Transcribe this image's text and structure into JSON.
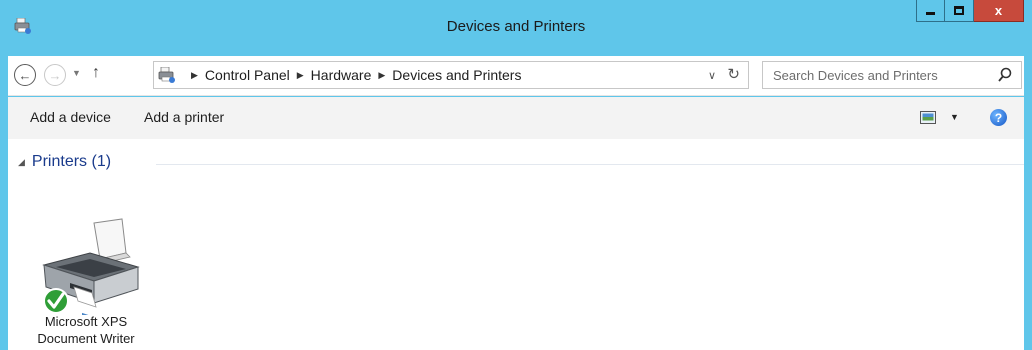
{
  "window": {
    "title": "Devices and Printers",
    "close_label": "x"
  },
  "address": {
    "crumbs": [
      "Control Panel",
      "Hardware",
      "Devices and Printers"
    ]
  },
  "search": {
    "placeholder": "Search Devices and Printers"
  },
  "commands": {
    "add_device": "Add a device",
    "add_printer": "Add a printer",
    "help_glyph": "?"
  },
  "groups": [
    {
      "title": "Printers (1)",
      "items": [
        {
          "name_line1": "Microsoft XPS",
          "name_line2": "Document Writer"
        }
      ]
    }
  ]
}
